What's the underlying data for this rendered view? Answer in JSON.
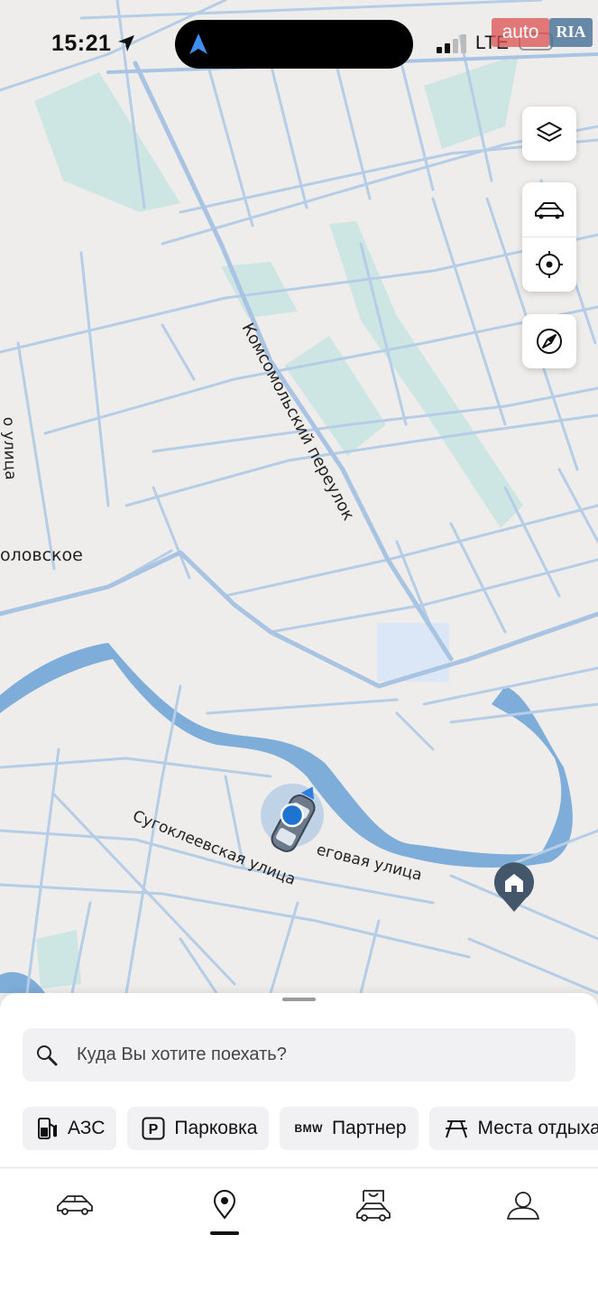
{
  "status_bar": {
    "time": "15:21",
    "network": "LTE"
  },
  "watermark": {
    "part1": "auto",
    "part2": "RIA"
  },
  "map": {
    "street_labels": {
      "komsomolsky": "Комсомольский переулок",
      "sugokleevskaya": "Сугоклеевская улица",
      "beregovaya": "еговая улица",
      "left_partial": "о улица",
      "village_partial": "оловское"
    },
    "colors": {
      "land": "#eeedeb",
      "road": "#b5cde6",
      "water": "#7fadd9",
      "park": "#cde6e4",
      "marker": "#1f73d0"
    }
  },
  "map_controls": {
    "icons": [
      "layers-icon",
      "car-icon",
      "target-icon",
      "compass-icon"
    ]
  },
  "search": {
    "placeholder": "Куда Вы хотите поехать?"
  },
  "quick_filters": [
    {
      "label": "АЗС",
      "icon": "fuel-pump-icon"
    },
    {
      "label": "Парковка",
      "icon": "parking-icon",
      "icon_text": "P"
    },
    {
      "label": "Партнер",
      "icon": "bmw-logo-icon",
      "icon_text": "BMW"
    },
    {
      "label": "Места отдыха",
      "icon": "picnic-table-icon"
    }
  ],
  "bottom_nav": {
    "tabs": [
      "car-tab",
      "map-tab",
      "services-tab",
      "profile-tab"
    ],
    "active": "map-tab"
  }
}
